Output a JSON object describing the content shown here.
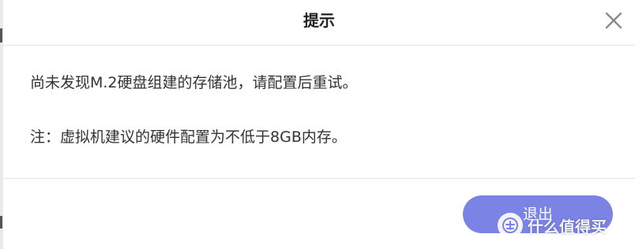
{
  "dialog": {
    "title": "提示",
    "close_icon": "close-icon",
    "message_line1": "尚未发现M.2硬盘组建的存储池，请配置后重试。",
    "message_line2": "注：虚拟机建议的硬件配置为不低于8GB内存。",
    "exit_label": "退出",
    "accent_color": "#7b83e4"
  },
  "watermark": {
    "logo_icon": "zhi-logo-icon",
    "text": "什么值得买"
  }
}
